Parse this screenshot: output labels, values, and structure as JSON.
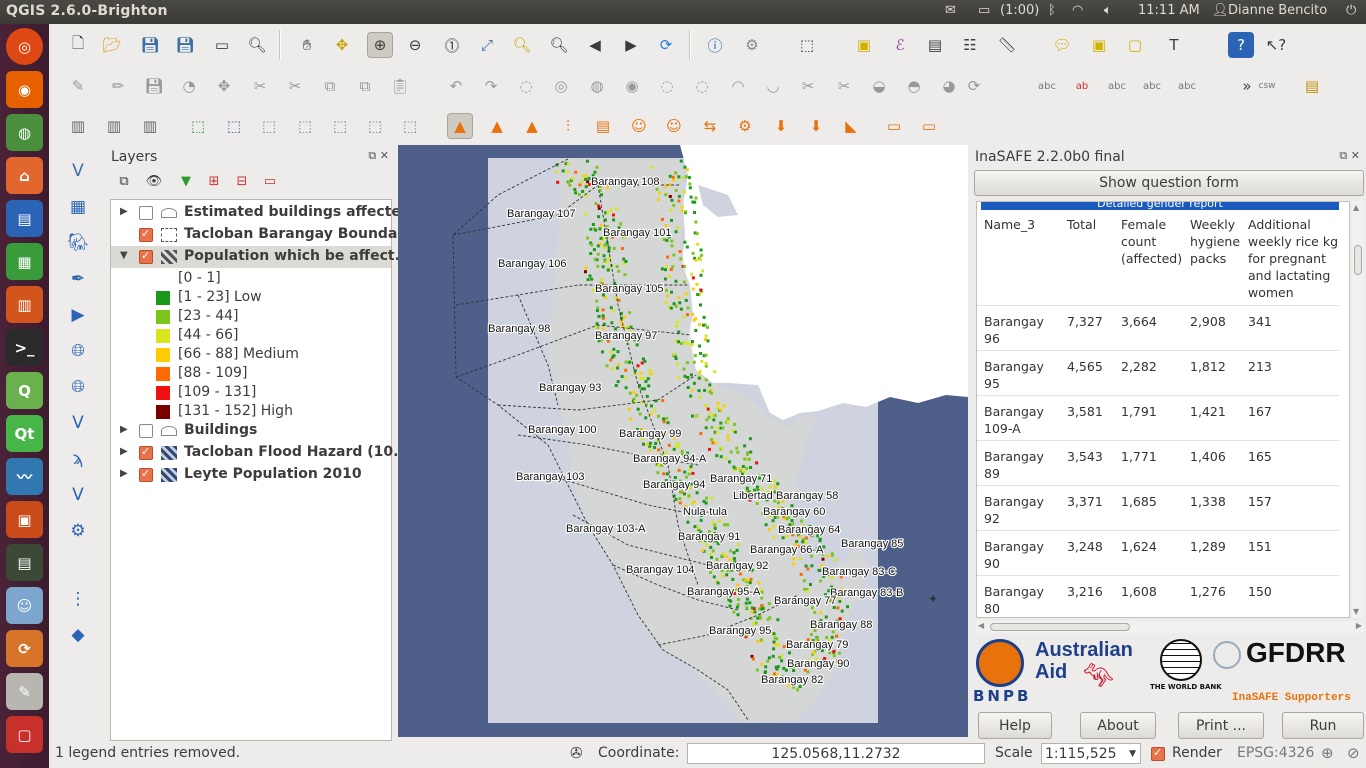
{
  "topbar": {
    "title": "QGIS 2.6.0-Brighton",
    "battery": "(1:00)",
    "clock": "11:11 AM",
    "user": "Dianne Bencito"
  },
  "toolbar": {
    "icons": [
      "new-project-icon",
      "open-project-icon",
      "save-project-icon",
      "save-as-icon",
      "new-print-composer-icon",
      "composer-manager-icon",
      "pan-icon",
      "pan-to-selection-icon",
      "zoom-in-icon",
      "zoom-out-icon",
      "zoom-actual-icon",
      "zoom-full-icon",
      "zoom-to-selection-icon",
      "zoom-to-layer-icon",
      "zoom-last-icon",
      "zoom-next-icon",
      "refresh-icon",
      "identify-icon",
      "action-icon",
      "select-feature-icon",
      "deselect-icon",
      "field-calculator-icon",
      "attribute-table-icon",
      "statistics-icon",
      "measure-icon",
      "annotation-icon",
      "new-annotation-icon",
      "text-annotation-icon",
      "help-icon",
      "whats-this-icon"
    ]
  },
  "layers_panel": {
    "title": "Layers",
    "items": [
      {
        "label": "Estimated buildings affected",
        "checked": false
      },
      {
        "label": "Tacloban Barangay Bounda...",
        "checked": true
      },
      {
        "label": "Population which be affect...",
        "checked": true
      },
      {
        "label": "Buildings",
        "checked": false
      },
      {
        "label": "Tacloban Flood Hazard (10...",
        "checked": true
      },
      {
        "label": "Leyte Population 2010",
        "checked": true
      }
    ],
    "legend": [
      {
        "label": "[0 - 1]",
        "color": "#ffffff"
      },
      {
        "label": "[1 - 23] Low",
        "color": "#1a9a1a"
      },
      {
        "label": "[23 - 44]",
        "color": "#7cc61c"
      },
      {
        "label": "[44 - 66]",
        "color": "#d8e51c"
      },
      {
        "label": "[66 - 88] Medium",
        "color": "#ffcc00"
      },
      {
        "label": "[88 - 109]",
        "color": "#ff6a00"
      },
      {
        "label": "[109 - 131]",
        "color": "#f01010"
      },
      {
        "label": "[131 - 152] High",
        "color": "#7a0000"
      }
    ]
  },
  "map": {
    "labels": [
      "Barangay 108",
      "Barangay 107",
      "Barangay 101",
      "Barangay 106",
      "Barangay 105",
      "Barangay 98",
      "Barangay 97",
      "Barangay 93",
      "Barangay 100",
      "Barangay 99",
      "Barangay 94-A",
      "Barangay 103",
      "Barangay 94",
      "Barangay 71",
      "Libertad",
      "Barangay 58",
      "Barangay 60",
      "Nula-tula",
      "Barangay 64",
      "Barangay 103-A",
      "Barangay 91",
      "Barangay 66-A",
      "Barangay 85",
      "Barangay 104",
      "Barangay 92",
      "Barangay 83-C",
      "Barangay 95-A",
      "Barangay 83-B",
      "Barangay 77",
      "Barangay 88",
      "Barangay 95",
      "Barangay 79",
      "Barangay 90",
      "Barangay 82"
    ]
  },
  "inasafe": {
    "title": "InaSAFE 2.2.0b0 final",
    "question_button": "Show question form",
    "report_heading": "Detailed gender report",
    "columns": [
      "Name_3",
      "Total",
      "Female count (affected)",
      "Weekly hygiene packs",
      "Additional weekly rice kg for pregnant and lactating women"
    ],
    "rows": [
      [
        "Barangay 96",
        "7,327",
        "3,664",
        "2,908",
        "341"
      ],
      [
        "Barangay 95",
        "4,565",
        "2,282",
        "1,812",
        "213"
      ],
      [
        "Barangay 109-A",
        "3,581",
        "1,791",
        "1,421",
        "167"
      ],
      [
        "Barangay 89",
        "3,543",
        "1,771",
        "1,406",
        "165"
      ],
      [
        "Barangay 92",
        "3,371",
        "1,685",
        "1,338",
        "157"
      ],
      [
        "Barangay 90",
        "3,248",
        "1,624",
        "1,289",
        "151"
      ],
      [
        "Barangay 80",
        "3,216",
        "1,608",
        "1,276",
        "150"
      ]
    ],
    "logos": {
      "bnpb": "BNPB",
      "australian_aid_1": "Australian",
      "australian_aid_2": "Aid",
      "world_bank": "THE WORLD BANK",
      "gfdrr": "GFDRR",
      "supporters": "InaSAFE Supporters"
    },
    "buttons": {
      "help": "Help",
      "about": "About",
      "print": "Print ...",
      "run": "Run"
    }
  },
  "status": {
    "message": "1 legend entries removed.",
    "coordinate_label": "Coordinate:",
    "coordinate_value": "125.0568,11.2732",
    "scale_label": "Scale",
    "scale_value": "1:115,525",
    "render_label": "Render",
    "render_checked": true,
    "crs": "EPSG:4326"
  }
}
